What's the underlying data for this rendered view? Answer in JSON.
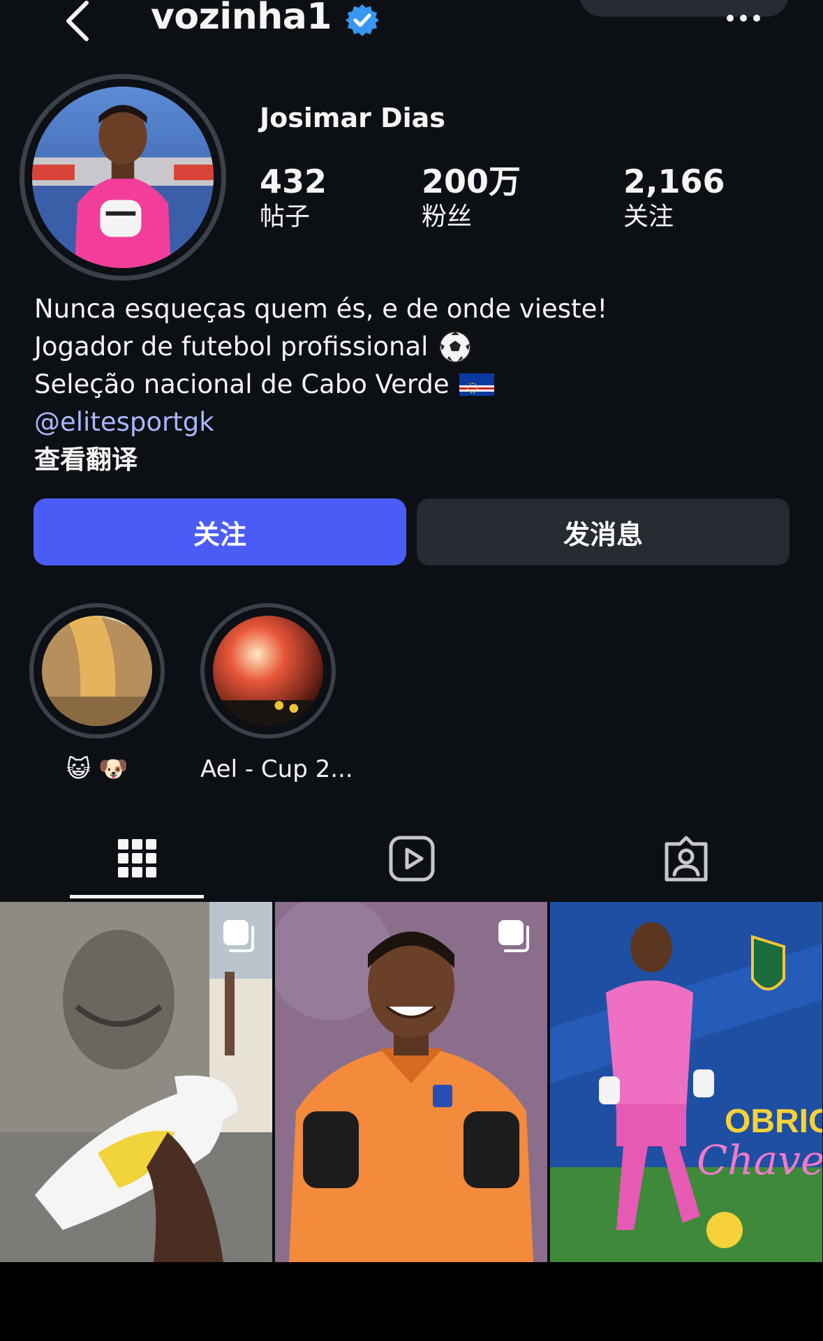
{
  "header": {
    "username": "vozinha1",
    "verified": true,
    "full_name": "Josimar Dias",
    "icons": {
      "back": "chevron-left-icon",
      "verified": "verified-badge-icon",
      "more": "more-horizontal-icon"
    }
  },
  "stats": [
    {
      "value": "432",
      "label": "帖子"
    },
    {
      "value": "200万",
      "label": "粉丝"
    },
    {
      "value": "2,166",
      "label": "关注"
    }
  ],
  "bio": {
    "line1": "Nunca esqueças quem és, e de onde vieste!",
    "line2": "Jogador de futebol profissional",
    "line3": "Seleção nacional de Cabo Verde",
    "link": "@elitesportgk",
    "translate": "查看翻译"
  },
  "actions": {
    "follow": "关注",
    "message": "发消息"
  },
  "highlights": [
    {
      "label": "😺 🐶"
    },
    {
      "label": "Ael - Cup 2..."
    }
  ],
  "tabs": [
    {
      "icon": "grid-icon",
      "active": true
    },
    {
      "icon": "reels-icon",
      "active": false
    },
    {
      "icon": "tagged-icon",
      "active": false
    }
  ],
  "colors": {
    "background": "#0c0f14",
    "follow_button": "#4a5cf5",
    "secondary_button": "#262a31",
    "link": "#a9b8ff",
    "verified": "#3797f0"
  }
}
